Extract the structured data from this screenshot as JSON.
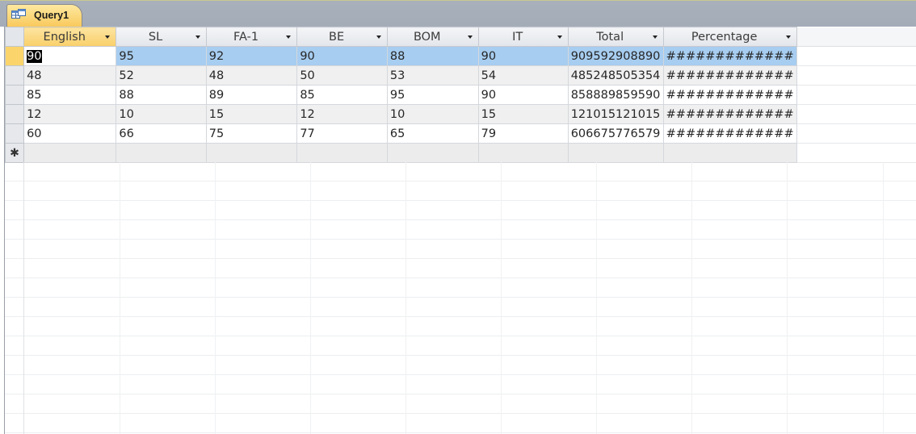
{
  "tab": {
    "label": "Query1",
    "icon": "query-icon"
  },
  "columns": [
    "English",
    "SL",
    "FA-1",
    "BE",
    "BOM",
    "IT",
    "Total",
    "Percentage"
  ],
  "rows": [
    [
      "90",
      "95",
      "92",
      "90",
      "88",
      "90",
      "909592908890",
      "#############"
    ],
    [
      "48",
      "52",
      "48",
      "50",
      "53",
      "54",
      "485248505354",
      "#############"
    ],
    [
      "85",
      "88",
      "89",
      "85",
      "95",
      "90",
      "858889859590",
      "#############"
    ],
    [
      "12",
      "10",
      "15",
      "12",
      "10",
      "15",
      "121015121015",
      "#############"
    ],
    [
      "60",
      "66",
      "75",
      "77",
      "65",
      "79",
      "606675776579",
      "#############"
    ]
  ],
  "new_record_marker": "✱",
  "colors": {
    "selected_row": "#a7cdf0",
    "current_selector": "#fbd56b",
    "tab_bg": "#f9c85a"
  }
}
